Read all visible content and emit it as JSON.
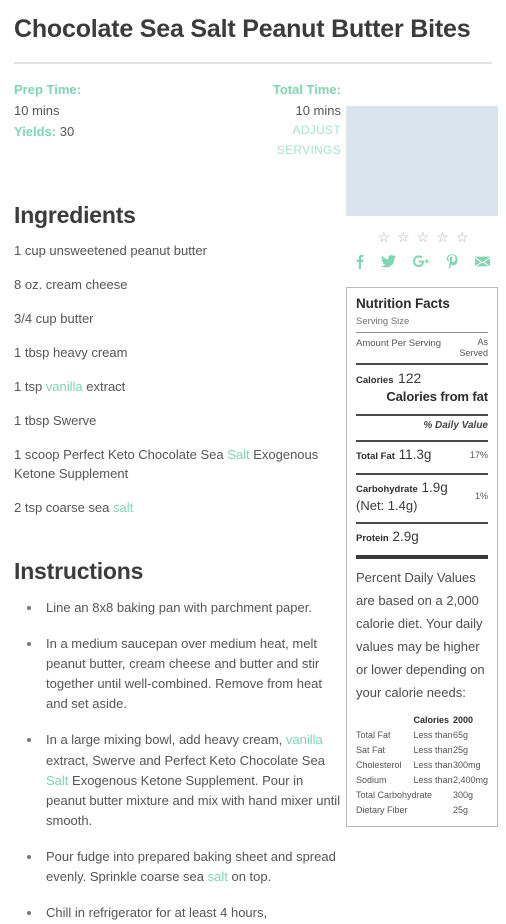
{
  "recipe": {
    "title": "Chocolate Sea Salt Peanut Butter Bites"
  },
  "meta": {
    "prep_time_label": "Prep Time:",
    "prep_time_value": "10 mins",
    "yields_label": "Yields:",
    "yields_value": "30",
    "total_time_label": "Total Time:",
    "total_time_value": "10 mins",
    "adjust_servings": "ADJUST SERVINGS"
  },
  "rating": {
    "star_glyph": "☆",
    "stars": [
      1,
      2,
      3,
      4,
      5
    ]
  },
  "social": [
    {
      "name": "facebook-icon",
      "glyph": "f"
    },
    {
      "name": "twitter-icon",
      "glyph": "t"
    },
    {
      "name": "googleplus-icon",
      "glyph": "g"
    },
    {
      "name": "pinterest-icon",
      "glyph": "p"
    },
    {
      "name": "email-icon",
      "glyph": "m"
    }
  ],
  "nutrition": {
    "title": "Nutrition Facts",
    "serving_size_label": "Serving Size",
    "amount_per_serving_label": "Amount Per Serving",
    "as_served_line1": "As",
    "as_served_line2": "Served",
    "calories_label": "Calories",
    "calories_value": "122",
    "calories_from_fat_label": "Calories from fat",
    "daily_value_label": "% Daily Value",
    "rows": [
      {
        "name": "Total Fat",
        "value": "11.3g",
        "sub": "",
        "pct": "17%"
      },
      {
        "name": "Carbohydrate",
        "value": "1.9g",
        "sub": "(Net: 1.4g)",
        "pct": "1%"
      },
      {
        "name": "Protein",
        "value": "2.9g",
        "sub": "",
        "pct": ""
      }
    ],
    "disclaimer": "Percent Daily Values are based on a 2,000 calorie diet. Your daily values may be higher or lower depending on your calorie needs:",
    "dv_headers": [
      "",
      "Calories",
      "2000"
    ],
    "dv_rows": [
      {
        "nutrient": "Total Fat",
        "qualifier": "Less than",
        "amount": "65g",
        "span": false
      },
      {
        "nutrient": "Sat Fat",
        "qualifier": "Less than",
        "amount": "25g",
        "span": false
      },
      {
        "nutrient": "Cholesterol",
        "qualifier": "Less than",
        "amount": "300mg",
        "span": false
      },
      {
        "nutrient": "Sodium",
        "qualifier": "Less than",
        "amount": "2,400mg",
        "span": false
      },
      {
        "nutrient": "Total Carbohydrate",
        "qualifier": "",
        "amount": "300g",
        "span": true
      },
      {
        "nutrient": "Dietary Fiber",
        "qualifier": "",
        "amount": "25g",
        "span": true
      }
    ]
  },
  "ingredients": {
    "heading": "Ingredients",
    "items": [
      [
        {
          "t": "1 cup unsweetened peanut butter",
          "link": false
        }
      ],
      [
        {
          "t": "8 oz. cream cheese",
          "link": false
        }
      ],
      [
        {
          "t": "3/4 cup butter",
          "link": false
        }
      ],
      [
        {
          "t": "1 tbsp heavy cream",
          "link": false
        }
      ],
      [
        {
          "t": "1 tsp ",
          "link": false
        },
        {
          "t": "vanilla",
          "link": true
        },
        {
          "t": " extract",
          "link": false
        }
      ],
      [
        {
          "t": "1 tbsp Swerve",
          "link": false
        }
      ],
      [
        {
          "t": "1 scoop Perfect Keto Chocolate Sea ",
          "link": false
        },
        {
          "t": "Salt",
          "link": true
        },
        {
          "t": " Exogenous Ketone Supplement",
          "link": false
        }
      ],
      [
        {
          "t": "2 tsp coarse sea ",
          "link": false
        },
        {
          "t": "salt",
          "link": true
        }
      ]
    ]
  },
  "instructions": {
    "heading": "Instructions",
    "items": [
      [
        {
          "t": "Line an 8x8 baking pan with parchment paper.",
          "link": false
        }
      ],
      [
        {
          "t": "In a medium saucepan over medium heat, melt peanut butter, cream cheese and butter and stir together until well-combined. Remove from heat and set aside.",
          "link": false
        }
      ],
      [
        {
          "t": "In a large mixing bowl, add heavy cream, ",
          "link": false
        },
        {
          "t": "vanilla",
          "link": true
        },
        {
          "t": " extract, Swerve and Perfect Keto Chocolate Sea ",
          "link": false
        },
        {
          "t": "Salt",
          "link": true
        },
        {
          "t": " Exogenous Ketone Supplement. Pour in peanut butter mixture and mix with hand mixer until smooth.",
          "link": false
        }
      ],
      [
        {
          "t": "Pour fudge into prepared baking sheet and spread evenly. Sprinkle coarse sea ",
          "link": false
        },
        {
          "t": "salt",
          "link": true
        },
        {
          "t": " on top.",
          "link": false
        }
      ],
      [
        {
          "t": "Chill in refrigerator for at least 4 hours,",
          "link": false
        }
      ]
    ]
  },
  "colors": {
    "accent_green": "#7ed6b2",
    "accent_green_light": "#a8e3ca",
    "text": "#555555",
    "heading": "#3b3b3b"
  }
}
